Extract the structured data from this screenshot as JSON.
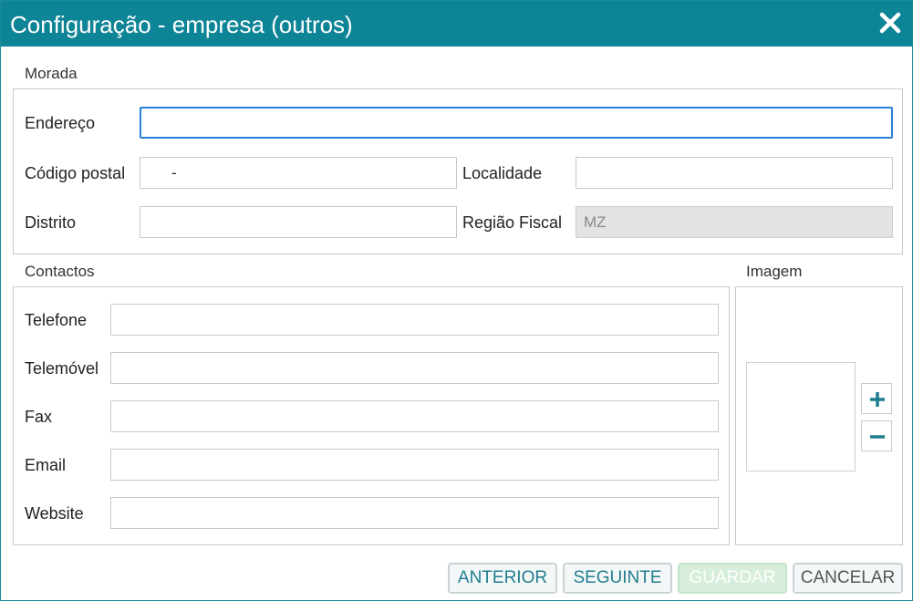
{
  "dialog": {
    "title": "Configuração - empresa (outros)",
    "close_icon": "close-icon"
  },
  "morada": {
    "section_label": "Morada",
    "endereco": {
      "label": "Endereço",
      "value": ""
    },
    "codigo_postal": {
      "label": "Código postal",
      "value": "",
      "separator": "-"
    },
    "localidade": {
      "label": "Localidade",
      "value": ""
    },
    "distrito": {
      "label": "Distrito",
      "value": ""
    },
    "regiao_fiscal": {
      "label": "Região Fiscal",
      "value": "MZ"
    }
  },
  "contactos": {
    "section_label": "Contactos",
    "telefone": {
      "label": "Telefone",
      "value": ""
    },
    "telemovel": {
      "label": "Telemóvel",
      "value": ""
    },
    "fax": {
      "label": "Fax",
      "value": ""
    },
    "email": {
      "label": "Email",
      "value": ""
    },
    "website": {
      "label": "Website",
      "value": ""
    }
  },
  "imagem": {
    "section_label": "Imagem",
    "add_icon": "plus-icon",
    "remove_icon": "minus-icon"
  },
  "footer": {
    "anterior_label": "ANTERIOR",
    "seguinte_label": "SEGUINTE",
    "guardar_label": "GUARDAR",
    "cancelar_label": "CANCELAR"
  },
  "colors": {
    "titlebar": "#0e8497",
    "accent_text": "#1f7e8d",
    "focus_border": "#2a7fd6",
    "disabled_button": "#d6eedb"
  }
}
